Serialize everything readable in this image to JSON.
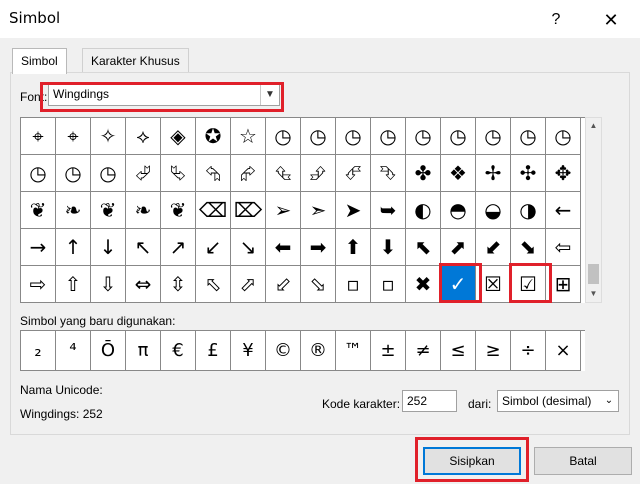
{
  "window": {
    "title": "Simbol",
    "help_label": "?",
    "close_label": "✕"
  },
  "tabs": [
    {
      "label": "Simbol",
      "active": true
    },
    {
      "label": "Karakter Khusus",
      "active": false
    }
  ],
  "font": {
    "label": "Font:",
    "value": "Wingdings"
  },
  "symbol_grid": {
    "rows": [
      [
        "⌖",
        "⌖",
        "✧",
        "⟡",
        "◈",
        "✪",
        "☆",
        "◷",
        "◷",
        "◷",
        "◷",
        "◷",
        "◷",
        "◷",
        "◷",
        "◷"
      ],
      [
        "◷",
        "◷",
        "◷",
        "⮰",
        "⮱",
        "⮲",
        "⮳",
        "⮴",
        "⮵",
        "⮶",
        "⮷",
        "✤",
        "❖",
        "✢",
        "✣",
        "✥"
      ],
      [
        "❦",
        "❧",
        "❦",
        "❧",
        "❦",
        "⌫",
        "⌦",
        "➢",
        "➣",
        "➤",
        "➥",
        "◐",
        "◓",
        "◒",
        "◑",
        "←"
      ],
      [
        "→",
        "↑",
        "↓",
        "↖",
        "↗",
        "↙",
        "↘",
        "⬅",
        "➡",
        "⬆",
        "⬇",
        "⬉",
        "⬈",
        "⬋",
        "⬊",
        "⇦"
      ],
      [
        "⇨",
        "⇧",
        "⇩",
        "⇔",
        "⇳",
        "⬁",
        "⬀",
        "⬃",
        "⬂",
        "▫",
        "▫",
        "✖",
        "✓",
        "☒",
        "☑",
        "⊞"
      ]
    ],
    "selected": {
      "row": 4,
      "col": 12
    }
  },
  "recent": {
    "label": "Simbol yang baru digunakan:",
    "symbols": [
      "₂",
      "⁴",
      "Ō",
      "π",
      "€",
      "£",
      "¥",
      "©",
      "®",
      "™",
      "±",
      "≠",
      "≤",
      "≥",
      "÷",
      "×"
    ]
  },
  "unicode": {
    "label": "Nama Unicode:",
    "value": "Wingdings: 252"
  },
  "char_code": {
    "label": "Kode karakter:",
    "value": "252"
  },
  "from": {
    "label": "dari:",
    "value": "Simbol (desimal)"
  },
  "buttons": {
    "insert": "Sisipkan",
    "cancel": "Batal"
  },
  "colors": {
    "highlight": "#e0202a",
    "selection": "#0078d7"
  }
}
